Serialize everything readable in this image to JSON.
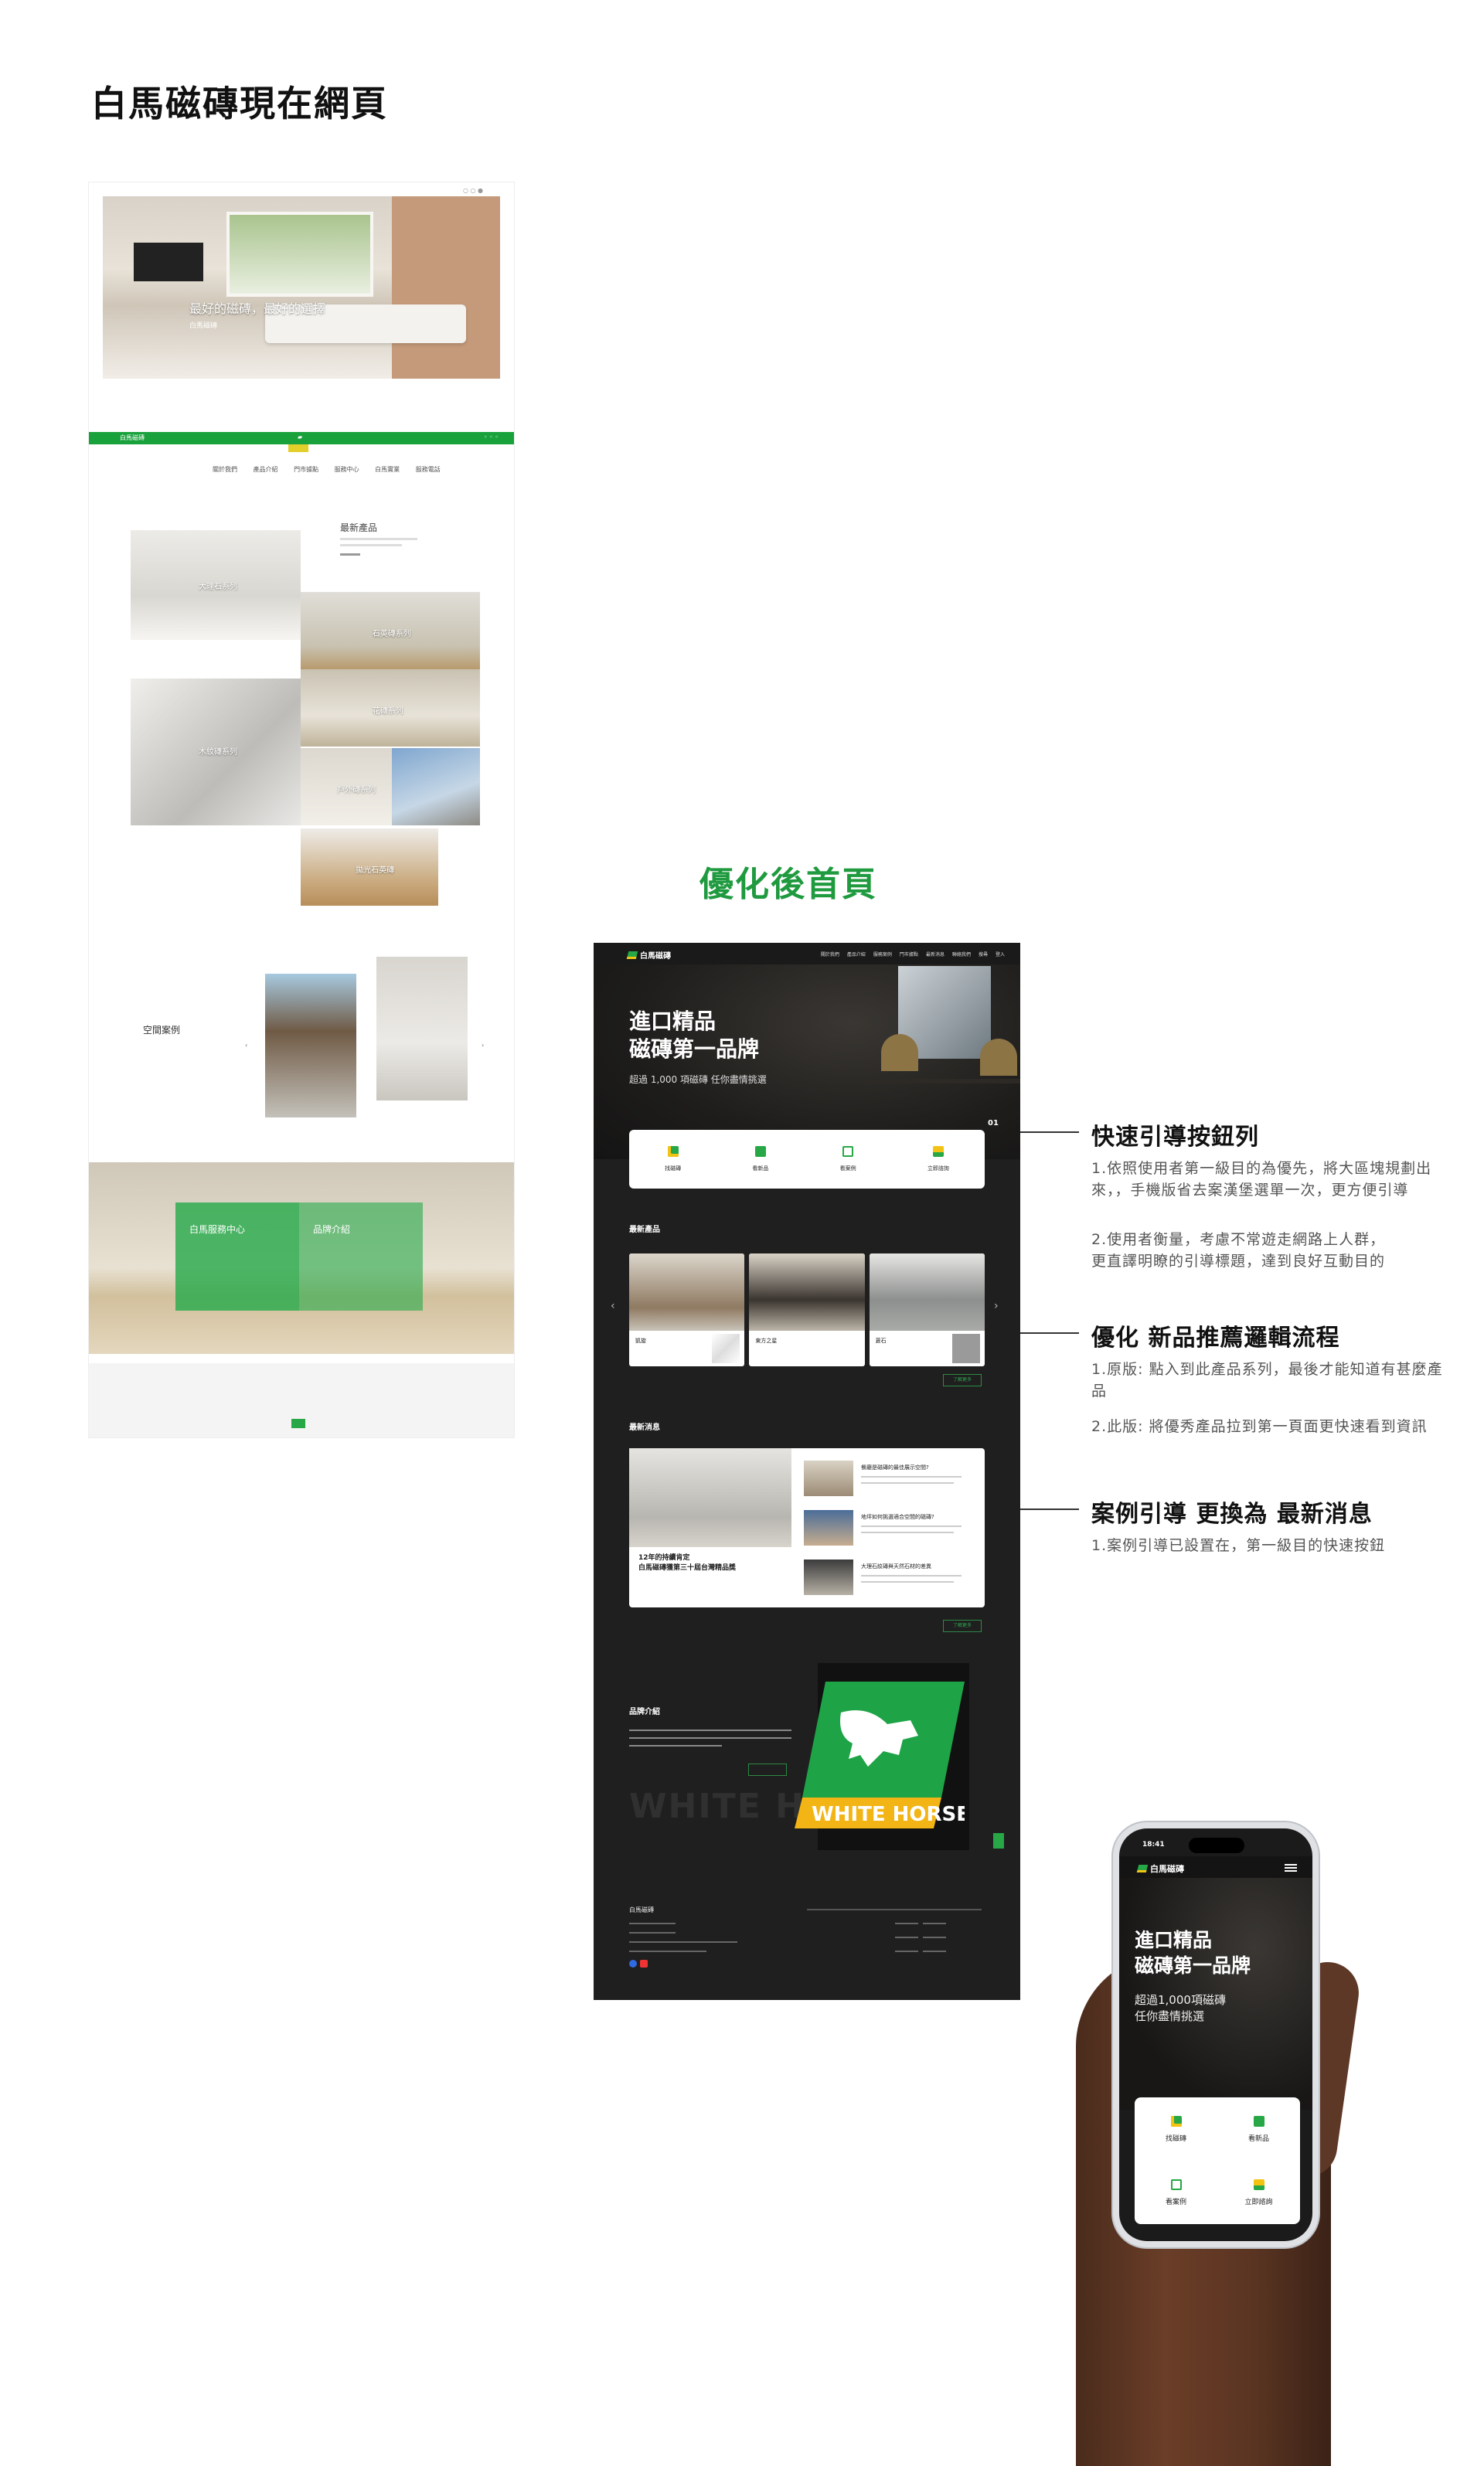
{
  "headings": {
    "current_title": "白馬磁磚現在網頁",
    "optimized_title": "優化後首頁"
  },
  "old_site": {
    "hero_caption": "最好的磁磚，最好的選擇",
    "hero_subcaption": "白馬磁磚",
    "brand": "白馬磁磚",
    "submenu": "關於我們 產品介紹 門市據點 服務中心 白馬實業 服務電話",
    "new_products_title": "最新產品",
    "tiles": [
      "大理石系列",
      "石英磚系列",
      "木紋磚系列",
      "花磚系列",
      "戶外磚系列",
      "拋光石英磚"
    ],
    "space_cases": "空間案例",
    "banner_left": "白馬服務中心",
    "banner_right": "品牌介紹"
  },
  "new_site": {
    "brand": "白馬磁磚",
    "nav_links": [
      "關於我們",
      "產品介紹",
      "服務案例",
      "門市據點",
      "最新消息",
      "聯絡我們",
      "搜尋",
      "登入"
    ],
    "hero_title_line1": "進口精品",
    "hero_title_line2": "磁磚第一品牌",
    "hero_sub": "超過 1,000 項磁磚 任你盡情挑選",
    "hero_counter": "01",
    "quick_buttons": [
      "找磁磚",
      "看新品",
      "看案例",
      "立即諮詢"
    ],
    "new_products_title": "最新產品",
    "products": [
      "凱旋",
      "東方之星",
      "蒼石"
    ],
    "more_label": "了解更多",
    "news_title": "最新消息",
    "news_featured_line1": "12年的持續肯定",
    "news_featured_line2": "白馬磁磚獲第三十屆台灣精品獎",
    "news_items": [
      "餐廳是磁磚的最佳展示空間?",
      "地坪如何挑選適合空間的磁磚?",
      "大理石紋磚與天然石材的差異"
    ],
    "brand_title": "品牌介紹",
    "brand_logo_text": "WHITE HORSE",
    "ghost_text": "WHITE HO",
    "footer_brand": "白馬磁磚"
  },
  "annotations": [
    {
      "title": "快速引導按鈕列",
      "points": [
        "1.依照使用者第一級目的為優先，將大區塊規劃出來，，手機版省去案漢堡選單一次，更方便引導",
        "2.使用者衡量，考慮不常遊走網路上人群，更直譯明瞭的引導標題，達到良好互動目的"
      ]
    },
    {
      "title": "優化 新品推薦邏輯流程",
      "points": [
        "1.原版: 點入到此產品系列，最後才能知道有甚麼產品",
        "2.此版: 將優秀產品拉到第一頁面更快速看到資訊"
      ]
    },
    {
      "title": "案例引導 更換為 最新消息",
      "points": [
        "1.案例引導已設置在，第一級目的快速按鈕"
      ]
    }
  ],
  "mobile": {
    "time": "18:41",
    "brand": "白馬磁磚",
    "hero_title_line1": "進口精品",
    "hero_title_line2": "磁磚第一品牌",
    "hero_sub_line1": "超過1,000項磁磚",
    "hero_sub_line2": "任你盡情挑選",
    "quick_buttons": [
      "找磁磚",
      "看新品",
      "看案例",
      "立即諮詢"
    ]
  },
  "colors": {
    "brand_green": "#27a745",
    "brand_yellow": "#f3c313",
    "heading_green": "#1f9a3f",
    "dark_bg": "#1f1f1f"
  }
}
